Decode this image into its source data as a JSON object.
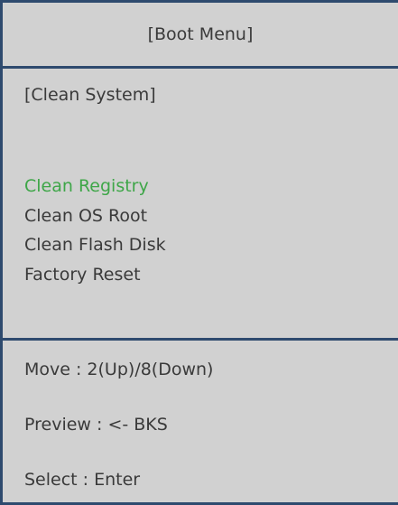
{
  "header": {
    "title": "[Boot Menu]"
  },
  "menu": {
    "section_title": "[Clean System]",
    "items": [
      {
        "label": "Clean Registry"
      },
      {
        "label": "Clean OS Root"
      },
      {
        "label": "Clean Flash Disk"
      },
      {
        "label": "Factory Reset"
      }
    ],
    "selected_index": 0
  },
  "help": {
    "move": "Move : 2(Up)/8(Down)",
    "preview": "Preview : <- BKS",
    "select": "Select : Enter"
  },
  "colors": {
    "background": "#d1d1d1",
    "border": "#2e4a6e",
    "text": "#3a3a3a",
    "selected": "#3ea648"
  }
}
